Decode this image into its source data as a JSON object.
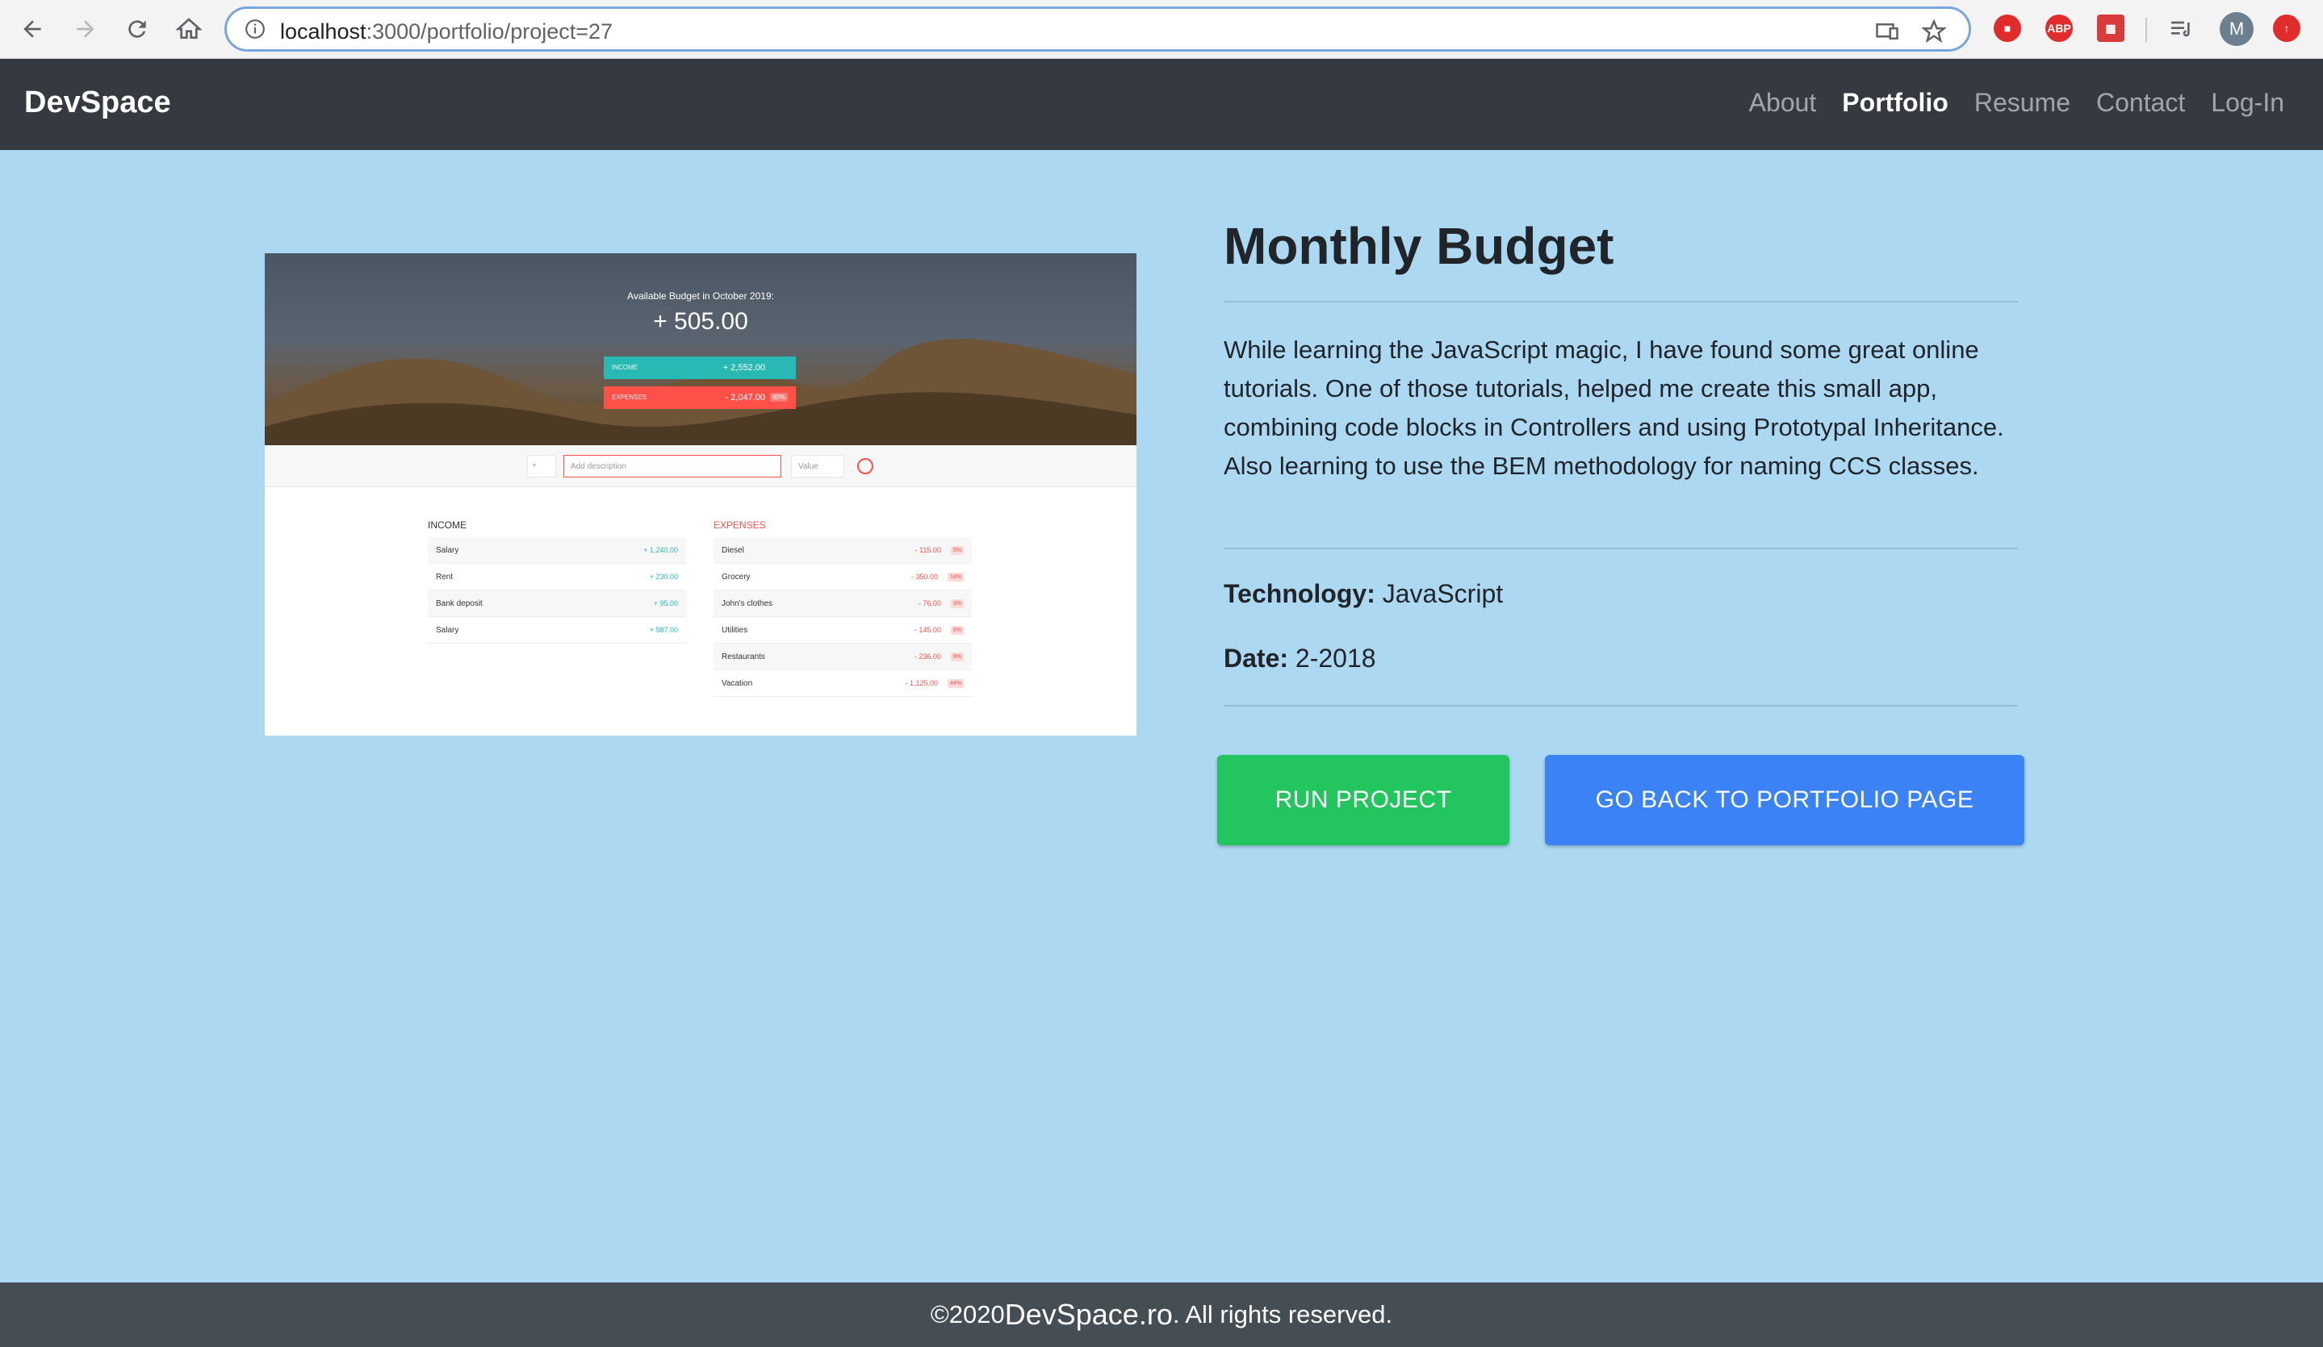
{
  "browser": {
    "url_host": "localhost",
    "url_rest": ":3000/portfolio/project=27",
    "avatar_letter": "M"
  },
  "navbar": {
    "brand": "DevSpace",
    "links": [
      {
        "label": "About",
        "active": false
      },
      {
        "label": "Portfolio",
        "active": true
      },
      {
        "label": "Resume",
        "active": false
      },
      {
        "label": "Contact",
        "active": false
      },
      {
        "label": "Log-In",
        "active": false
      }
    ]
  },
  "preview": {
    "header_label": "Available Budget in October 2019:",
    "header_value": "+ 505.00",
    "income_label": "INCOME",
    "income_value": "+ 2,552.00",
    "expenses_label": "EXPENSES",
    "expenses_value": "- 2,047.00",
    "expenses_pct": "80%",
    "add_type": "+",
    "add_desc_placeholder": "Add description",
    "add_value_placeholder": "Value",
    "income_title": "Income",
    "expenses_title": "Expenses",
    "income_items": [
      {
        "name": "Salary",
        "value": "+ 1,240.00"
      },
      {
        "name": "Rent",
        "value": "+ 230.00"
      },
      {
        "name": "Bank deposit",
        "value": "+ 95.00"
      },
      {
        "name": "Salary",
        "value": "+ 987.00"
      }
    ],
    "expense_items": [
      {
        "name": "Diesel",
        "value": "- 115.00",
        "pct": "5%"
      },
      {
        "name": "Grocery",
        "value": "- 350.00",
        "pct": "14%"
      },
      {
        "name": "John's clothes",
        "value": "- 76.00",
        "pct": "3%"
      },
      {
        "name": "Utilities",
        "value": "- 145.00",
        "pct": "6%"
      },
      {
        "name": "Restaurants",
        "value": "- 236.00",
        "pct": "9%"
      },
      {
        "name": "Vacation",
        "value": "- 1,125.00",
        "pct": "44%"
      }
    ]
  },
  "project": {
    "title": "Monthly Budget",
    "description": "While learning the JavaScript magic, I have found some great online tutorials. One of those tutorials, helped me create this small app, combining code blocks in Controllers and using Prototypal Inheritance. Also learning to use the BEM methodology for naming CCS classes.",
    "technology_label": "Technology:",
    "technology_value": "JavaScript",
    "date_label": "Date:",
    "date_value": "2-2018",
    "run_button": "RUN PROJECT",
    "back_button": "GO BACK TO PORTFOLIO PAGE"
  },
  "footer": {
    "prefix": "©2020 ",
    "brand": "DevSpace.ro",
    "suffix": ". All rights reserved."
  },
  "colors": {
    "page_bg": "#acd8f1",
    "navbar_bg": "#343a40",
    "run_button": "#22c55e",
    "back_button": "#3b82f6",
    "footer_bg": "#454d55"
  }
}
